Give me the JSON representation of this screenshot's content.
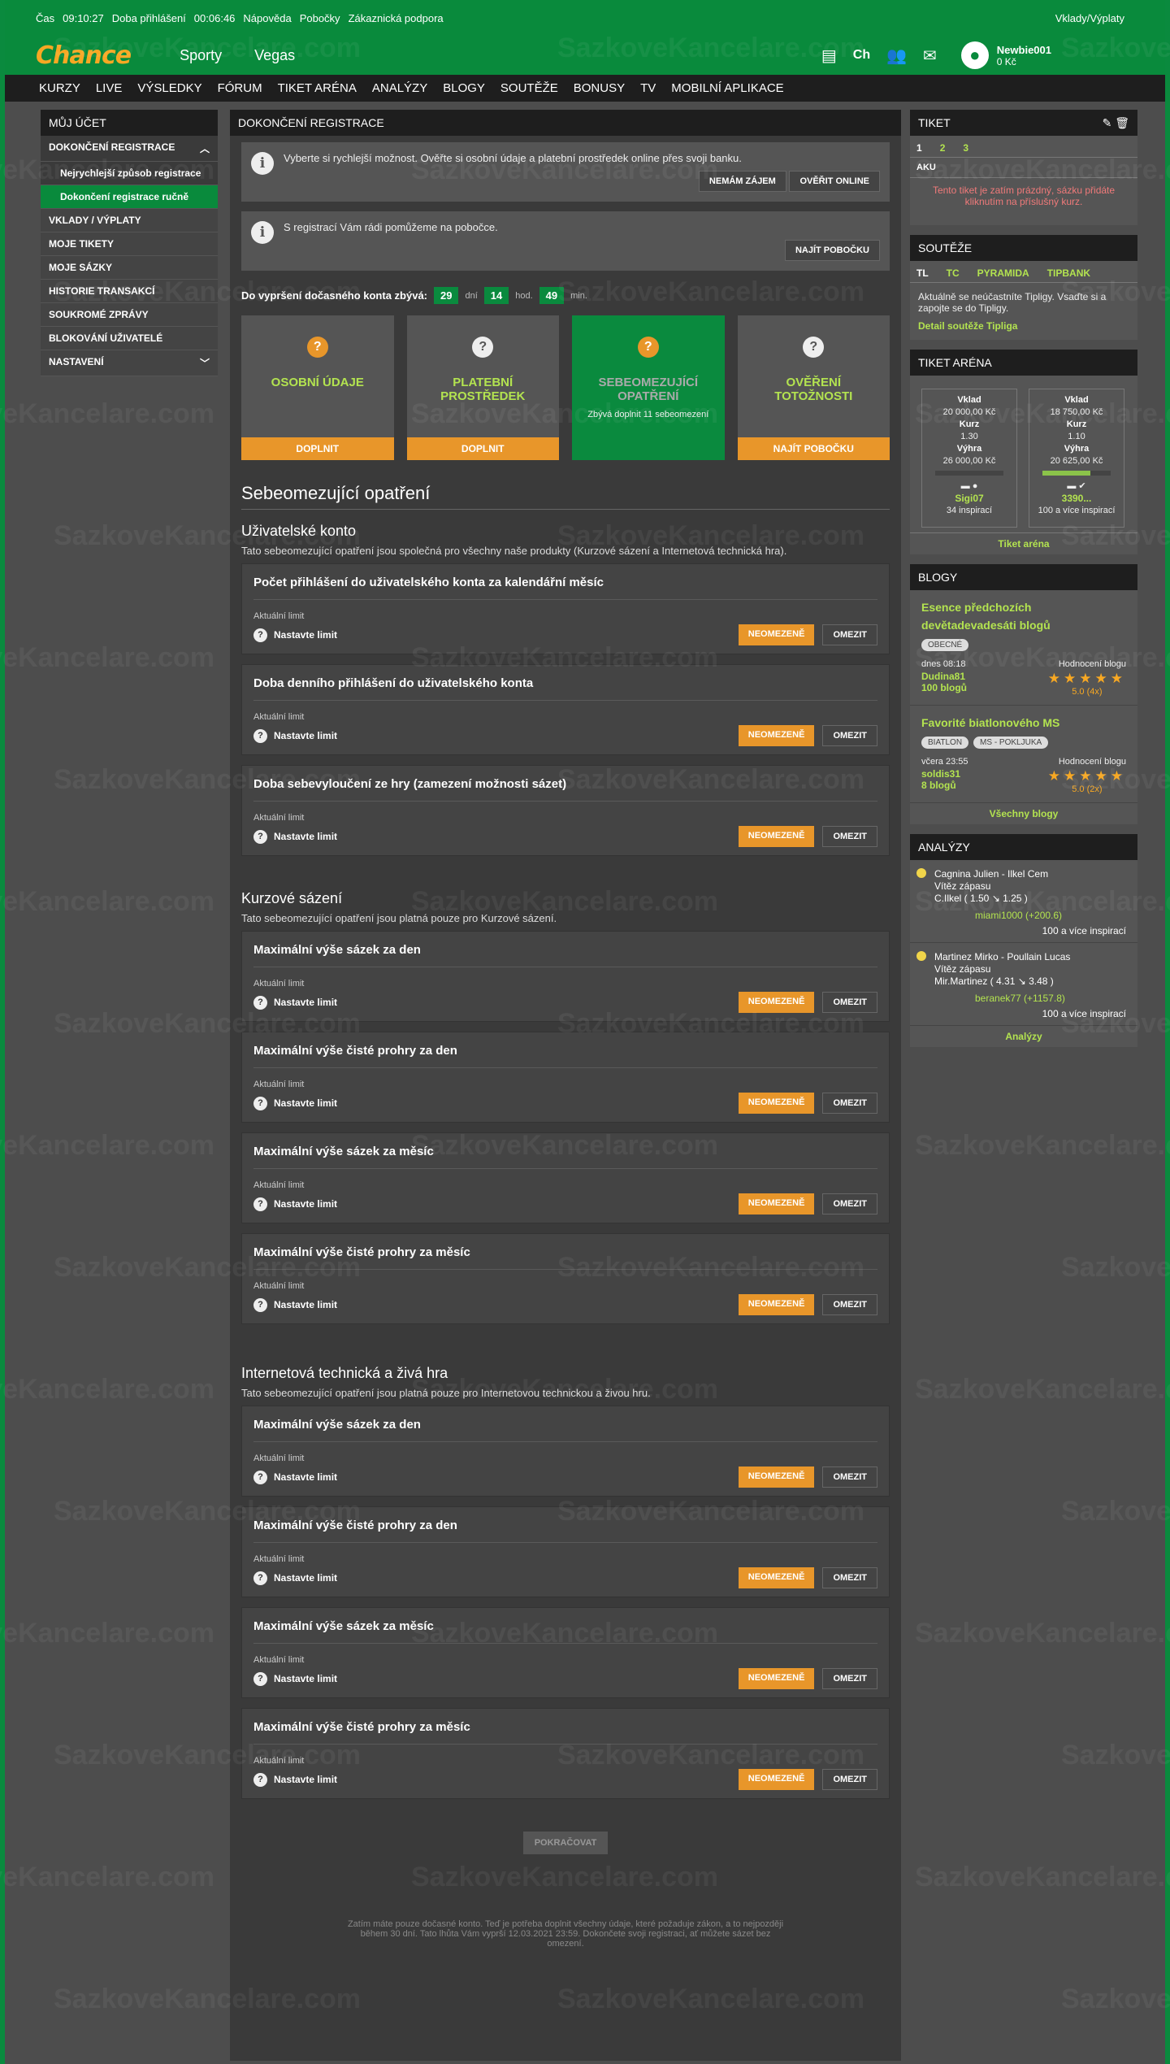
{
  "topbar": {
    "cas_label": "Čas",
    "cas": "09:10:27",
    "doba_label": "Doba přihlášení",
    "doba": "00:06:46",
    "napoveda": "Nápověda",
    "pobocky": "Pobočky",
    "podpora": "Zákaznická podpora",
    "vklady": "Vklady/Výplaty"
  },
  "header": {
    "logo": "Chance",
    "nav": [
      "Sporty",
      "Vegas"
    ],
    "user": "Newbie001",
    "balance": "0 Kč",
    "ch": "Ch"
  },
  "menu": [
    "KURZY",
    "LIVE",
    "VÝSLEDKY",
    "FÓRUM",
    "TIKET ARÉNA",
    "ANALÝZY",
    "BLOGY",
    "SOUTĚŽE",
    "BONUSY",
    "TV",
    "MOBILNÍ APLIKACE"
  ],
  "left": {
    "title": "MŮJ ÚČET",
    "items": [
      "DOKONČENÍ REGISTRACE",
      "Nejrychlejší způsob registrace",
      "Dokončení registrace ručně",
      "VKLADY / VÝPLATY",
      "MOJE TIKETY",
      "MOJE SÁZKY",
      "HISTORIE TRANSAKCÍ",
      "SOUKROMÉ ZPRÁVY",
      "BLOKOVÁNÍ UŽIVATELÉ",
      "NASTAVENÍ"
    ]
  },
  "main": {
    "title": "DOKONČENÍ REGISTRACE",
    "info1": "Vyberte si rychlejší možnost. Ověřte si osobní údaje a platební prostředek online přes svoji banku.",
    "btn_nemam": "NEMÁM ZÁJEM",
    "btn_overit": "OVĚŘIT ONLINE",
    "info2": "S registrací Vám rádi pomůžeme na pobočce.",
    "btn_najit": "NAJÍT POBOČKU",
    "timer_label": "Do vypršení dočasného konta zbývá:",
    "days": "29",
    "days_u": "dní",
    "hours": "14",
    "hours_u": "hod.",
    "mins": "49",
    "mins_u": "min.",
    "steps": [
      {
        "t": "OSOBNÍ ÚDAJE",
        "b": "DOPLNIT"
      },
      {
        "t": "PLATEBNÍ PROSTŘEDEK",
        "b": "DOPLNIT"
      },
      {
        "t": "SEBEOMEZUJÍCÍ OPATŘENÍ",
        "s": "Zbývá doplnit 11 sebeomezení"
      },
      {
        "t": "OVĚŘENÍ TOTOŽNOSTI",
        "b": "NAJÍT POBOČKU"
      }
    ],
    "h2": "Sebeomezující opatření",
    "aktualni": "Aktuální limit",
    "nastavte": "Nastavte limit",
    "neomezene": "NEOMEZENĚ",
    "omezit": "OMEZIT",
    "sections": [
      {
        "title": "Uživatelské konto",
        "desc": "Tato sebeomezující opatření jsou společná pro všechny naše produkty (Kurzové sázení a Internetová technická hra).",
        "items": [
          "Počet přihlášení do uživatelského konta za kalendářní měsíc",
          "Doba denního přihlášení do uživatelského konta",
          "Doba sebevyloučení ze hry (zamezení možnosti sázet)"
        ]
      },
      {
        "title": "Kurzové sázení",
        "desc": "Tato sebeomezující opatření jsou platná pouze pro Kurzové sázení.",
        "items": [
          "Maximální výše sázek za den",
          "Maximální výše čisté prohry za den",
          "Maximální výše sázek za měsíc",
          "Maximální výše čisté prohry za měsíc"
        ]
      },
      {
        "title": "Internetová technická a živá hra",
        "desc": "Tato sebeomezující opatření jsou platná pouze pro Internetovou technickou a živou hru.",
        "items": [
          "Maximální výše sázek za den",
          "Maximální výše čisté prohry za den",
          "Maximální výše sázek za měsíc",
          "Maximální výše čisté prohry za měsíc"
        ]
      }
    ],
    "pokracovat": "POKRAČOVAT",
    "footnote": "Zatím máte pouze dočasné konto. Teď je potřeba doplnit všechny údaje, které požaduje zákon, a to nejpozději během 30 dní. Tato lhůta Vám vyprší 12.03.2021 23:59. Dokončete svoji registraci, ať můžete sázet bez omezení."
  },
  "tiket": {
    "title": "TIKET",
    "tabs": [
      "1",
      "2",
      "3"
    ],
    "aku": "AKU",
    "empty": "Tento tiket je zatím prázdný, sázku přidáte kliknutím na příslušný kurz."
  },
  "souteze": {
    "title": "SOUTĚŽE",
    "tabs": [
      "TL",
      "TC",
      "PYRAMIDA",
      "TIPBANK"
    ],
    "text": "Aktuálně se neúčastníte Tipligy. Vsaďte si a zapojte se do Tipligy.",
    "link": "Detail soutěže Tipliga"
  },
  "arena": {
    "title": "TIKET ARÉNA",
    "cards": [
      {
        "vklad": "20 000,00 Kč",
        "kurz": "1.30",
        "vyhra": "26 000,00 Kč",
        "user": "Sigi07",
        "insp": "34 inspirací"
      },
      {
        "vklad": "18 750,00 Kč",
        "kurz": "1.10",
        "vyhra": "20 625,00 Kč",
        "user": "3390...",
        "insp": "100 a více inspirací"
      }
    ],
    "lbl_vklad": "Vklad",
    "lbl_kurz": "Kurz",
    "lbl_vyhra": "Výhra",
    "link": "Tiket aréna"
  },
  "blogy": {
    "title": "BLOGY",
    "items": [
      {
        "t": "Esence předchozích devětadevadesáti blogů",
        "tags": [
          "OBECNÉ"
        ],
        "date": "dnes 08:18",
        "user": "Dudina81",
        "count": "100 blogů",
        "score": "5.0",
        "n": "(4x)"
      },
      {
        "t": "Favorité biatlonového MS",
        "tags": [
          "BIATLON",
          "MS - POKLJUKA"
        ],
        "date": "včera 23:55",
        "user": "soldis31",
        "count": "8 blogů",
        "score": "5.0",
        "n": "(2x)"
      }
    ],
    "hodnoceni": "Hodnocení blogu",
    "link": "Všechny blogy"
  },
  "analyzy": {
    "title": "ANALÝZY",
    "items": [
      {
        "m": "Cagnina Julien - Ilkel Cem",
        "t": "Vítěz zápasu",
        "p": "C.Ilkel ( 1.50 ↘ 1.25 )",
        "u": "miami1000 (+200.6)",
        "i": "100 a více inspirací"
      },
      {
        "m": "Martinez Mirko - Poullain Lucas",
        "t": "Vítěz zápasu",
        "p": "Mir.Martinez ( 4.31 ↘ 3.48 )",
        "u": "beranek77 (+1157.8)",
        "i": "100 a více inspirací"
      }
    ],
    "link": "Analýzy"
  },
  "watermark": "SazkoveKancelare.com"
}
